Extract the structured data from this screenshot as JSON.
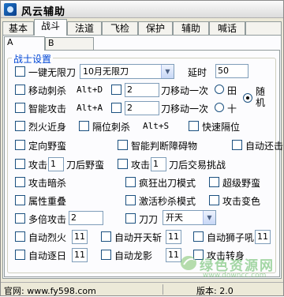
{
  "window": {
    "title": "风云辅助"
  },
  "main_tabs": [
    "基本",
    "战斗",
    "法道",
    "飞检",
    "保护",
    "辅助",
    "喊话",
    ""
  ],
  "sub_tabs": [
    "A",
    "B"
  ],
  "group": {
    "title": "战士设置"
  },
  "rows": {
    "yijian": {
      "label": "一键无限刀",
      "select": "10月无限刀",
      "delay_label": "延时",
      "delay_value": "50"
    },
    "move_assassin": {
      "label": "移动刺杀",
      "hotkey": "Alt+D",
      "value": "2",
      "blade_move": "刀移动一次",
      "radio_tian": "田",
      "random_label": "随机"
    },
    "smart_attack": {
      "label": "智能攻击",
      "hotkey": "Alt+A",
      "value": "2",
      "blade_move": "刀移动一次",
      "radio_shi": "十"
    },
    "row3": {
      "a": "烈火近身",
      "b": "隔位刺杀",
      "hotkey": "Alt+S",
      "c": "快速隔位"
    },
    "row4": {
      "a": "定向野蛮",
      "b": "智能判断障碍物",
      "c": "自动还击"
    },
    "row5": {
      "a": "攻击",
      "a_val": "1",
      "a_suffix": "刀后野蛮",
      "b": "攻击",
      "b_val": "1",
      "b_suffix": "刀后交易挑战"
    },
    "row6": {
      "a": "攻击暗杀",
      "b": "疯狂出刀模式",
      "c": "超级野蛮"
    },
    "row7": {
      "a": "属性重叠",
      "b": "激活秒杀模式",
      "c": "攻击变色"
    },
    "row8": {
      "a": "多倍攻击",
      "a_val": "2",
      "b": "刀刀",
      "select": "开天"
    },
    "row9": {
      "a": "自动烈火",
      "a_val": "11",
      "b": "自动开天斩",
      "b_val": "11",
      "c": "自动狮子吼",
      "c_val": "11"
    },
    "row10": {
      "a": "自动逐日",
      "a_val": "11",
      "b": "自动龙影",
      "b_val": "11",
      "c": "攻击转身"
    }
  },
  "status": {
    "site": "官网: www.fy598.com",
    "version": "版本: 2.0"
  },
  "watermark": {
    "text": "绿色资源网",
    "url": "www.downcc.com"
  },
  "colors": {
    "group_title": "#0046d5",
    "watermark": "#5cb85c"
  }
}
